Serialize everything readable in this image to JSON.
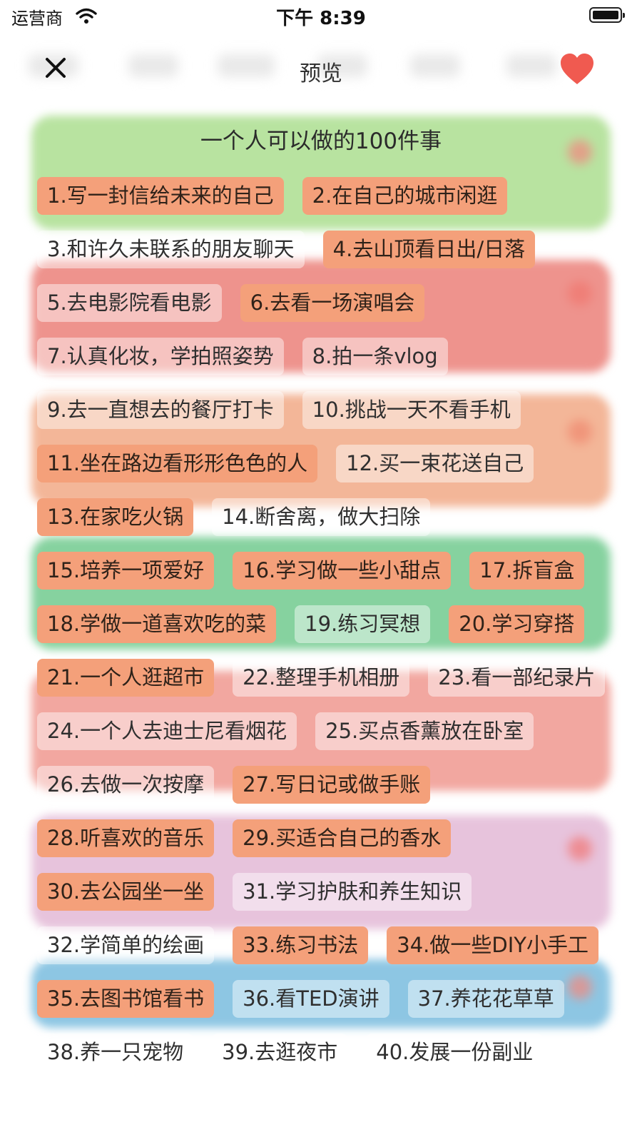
{
  "status_bar": {
    "carrier": "运营商",
    "time": "下午 8:39"
  },
  "nav": {
    "title": "预览"
  },
  "colors": {
    "tag_selected": "#f4a07a",
    "heart": "#f05a50",
    "bg_green": "#b8e3a0",
    "bg_red": "#ee938d",
    "bg_peach": "#f3b698",
    "bg_mint": "#86d29f",
    "bg_rose": "#f2a7a0",
    "bg_lavender": "#e7c3dc",
    "bg_blue": "#8dc6e3"
  },
  "list": {
    "title": "一个人可以做的100件事",
    "items": [
      {
        "label": "1.写一封信给未来的自己",
        "selected": true
      },
      {
        "label": "2.在自己的城市闲逛",
        "selected": true
      },
      {
        "label": "3.和许久未联系的朋友聊天",
        "selected": false
      },
      {
        "label": "4.去山顶看日出/日落",
        "selected": true
      },
      {
        "label": "5.去电影院看电影",
        "selected": false
      },
      {
        "label": "6.去看一场演唱会",
        "selected": true
      },
      {
        "label": "7.认真化妆，学拍照姿势",
        "selected": false
      },
      {
        "label": "8.拍一条vlog",
        "selected": false
      },
      {
        "label": "9.去一直想去的餐厅打卡",
        "selected": false
      },
      {
        "label": "10.挑战一天不看手机",
        "selected": false
      },
      {
        "label": "11.坐在路边看形形色色的人",
        "selected": true
      },
      {
        "label": "12.买一束花送自己",
        "selected": false
      },
      {
        "label": "13.在家吃火锅",
        "selected": true
      },
      {
        "label": "14.断舍离，做大扫除",
        "selected": false
      },
      {
        "label": "15.培养一项爱好",
        "selected": true
      },
      {
        "label": "16.学习做一些小甜点",
        "selected": true
      },
      {
        "label": "17.拆盲盒",
        "selected": true
      },
      {
        "label": "18.学做一道喜欢吃的菜",
        "selected": true
      },
      {
        "label": "19.练习冥想",
        "selected": false
      },
      {
        "label": "20.学习穿搭",
        "selected": true
      },
      {
        "label": "21.一个人逛超市",
        "selected": true
      },
      {
        "label": "22.整理手机相册",
        "selected": false
      },
      {
        "label": "23.看一部纪录片",
        "selected": false
      },
      {
        "label": "24.一个人去迪士尼看烟花",
        "selected": false
      },
      {
        "label": "25.买点香薰放在卧室",
        "selected": false
      },
      {
        "label": "26.去做一次按摩",
        "selected": false
      },
      {
        "label": "27.写日记或做手账",
        "selected": true
      },
      {
        "label": "28.听喜欢的音乐",
        "selected": true
      },
      {
        "label": "29.买适合自己的香水",
        "selected": true
      },
      {
        "label": "30.去公园坐一坐",
        "selected": true
      },
      {
        "label": "31.学习护肤和养生知识",
        "selected": false
      },
      {
        "label": "32.学简单的绘画",
        "selected": false
      },
      {
        "label": "33.练习书法",
        "selected": true
      },
      {
        "label": "34.做一些DIY小手工",
        "selected": true
      },
      {
        "label": "35.去图书馆看书",
        "selected": true
      },
      {
        "label": "36.看TED演讲",
        "selected": false
      },
      {
        "label": "37.养花花草草",
        "selected": false
      },
      {
        "label": "38.养一只宠物",
        "selected": false
      },
      {
        "label": "39.去逛夜市",
        "selected": false
      },
      {
        "label": "40.发展一份副业",
        "selected": false
      }
    ]
  }
}
